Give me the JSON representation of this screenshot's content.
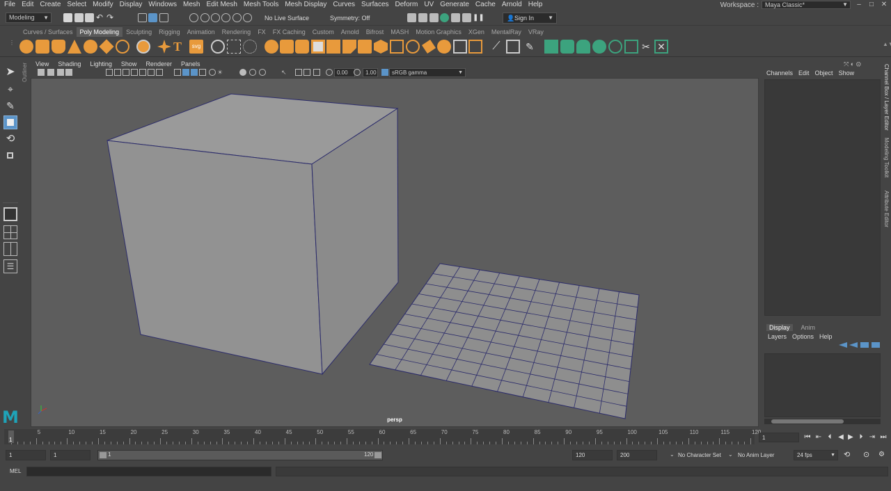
{
  "menubar": {
    "items": [
      "File",
      "Edit",
      "Create",
      "Select",
      "Modify",
      "Display",
      "Windows",
      "Mesh",
      "Edit Mesh",
      "Mesh Tools",
      "Mesh Display",
      "Curves",
      "Surfaces",
      "Deform",
      "UV",
      "Generate",
      "Cache",
      "Arnold",
      "Help"
    ],
    "workspace_label": "Workspace :",
    "workspace_value": "Maya Classic*"
  },
  "statusline": {
    "mode": "Modeling",
    "live_surface": "No Live Surface",
    "symmetry": "Symmetry: Off",
    "sign_in": "Sign In"
  },
  "shelf": {
    "tabs": [
      "Curves / Surfaces",
      "Poly Modeling",
      "Sculpting",
      "Rigging",
      "Animation",
      "Rendering",
      "FX",
      "FX Caching",
      "Custom",
      "Arnold",
      "Bifrost",
      "MASH",
      "Motion Graphics",
      "XGen",
      "MentalRay",
      "VRay"
    ],
    "active_tab": "Poly Modeling",
    "svg_label": "svg"
  },
  "outliner_tab": "Outliner",
  "panel": {
    "menus": [
      "View",
      "Shading",
      "Lighting",
      "Show",
      "Renderer",
      "Panels"
    ],
    "exposure": "0.00",
    "gamma": "1.00",
    "color_space": "sRGB gamma",
    "camera": "persp"
  },
  "channelbox": {
    "menus": [
      "Channels",
      "Edit",
      "Object",
      "Show"
    ]
  },
  "layereditor": {
    "tabs": [
      "Display",
      "Anim"
    ],
    "active_tab": "Display",
    "menus": [
      "Layers",
      "Options",
      "Help"
    ]
  },
  "right_tabs": [
    "Channel Box / Layer Editor",
    "Modeling Toolkit",
    "Attribute Editor"
  ],
  "timeline": {
    "ticks": [
      1,
      5,
      10,
      15,
      20,
      25,
      30,
      35,
      40,
      45,
      50,
      55,
      60,
      65,
      70,
      75,
      80,
      85,
      90,
      95,
      100,
      105,
      110,
      115,
      120
    ],
    "current_frame": "1",
    "current_frame_field": "1"
  },
  "range": {
    "start": "1",
    "playback_start": "1",
    "slider_start": "1",
    "slider_end": "120",
    "playback_end": "120",
    "end": "200",
    "character_set": "No Character Set",
    "anim_layer": "No Anim Layer",
    "fps": "24 fps"
  },
  "cmdline": {
    "label": "MEL"
  },
  "colors": {
    "accent_blue": "#5b94c8",
    "shelf_orange": "#e89a3c",
    "shelf_teal": "#3ca37e",
    "wireframe": "#2a2a6a",
    "maya_logo": "#1fa3b8"
  }
}
